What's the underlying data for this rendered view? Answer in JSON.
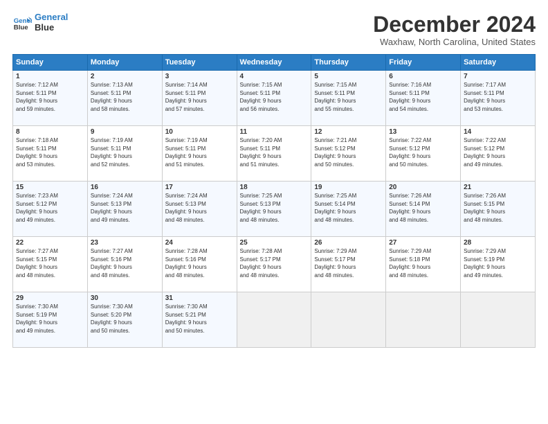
{
  "logo": {
    "line1": "General",
    "line2": "Blue"
  },
  "title": "December 2024",
  "location": "Waxhaw, North Carolina, United States",
  "headers": [
    "Sunday",
    "Monday",
    "Tuesday",
    "Wednesday",
    "Thursday",
    "Friday",
    "Saturday"
  ],
  "weeks": [
    [
      {
        "day": "1",
        "info": "Sunrise: 7:12 AM\nSunset: 5:11 PM\nDaylight: 9 hours\nand 59 minutes."
      },
      {
        "day": "2",
        "info": "Sunrise: 7:13 AM\nSunset: 5:11 PM\nDaylight: 9 hours\nand 58 minutes."
      },
      {
        "day": "3",
        "info": "Sunrise: 7:14 AM\nSunset: 5:11 PM\nDaylight: 9 hours\nand 57 minutes."
      },
      {
        "day": "4",
        "info": "Sunrise: 7:15 AM\nSunset: 5:11 PM\nDaylight: 9 hours\nand 56 minutes."
      },
      {
        "day": "5",
        "info": "Sunrise: 7:15 AM\nSunset: 5:11 PM\nDaylight: 9 hours\nand 55 minutes."
      },
      {
        "day": "6",
        "info": "Sunrise: 7:16 AM\nSunset: 5:11 PM\nDaylight: 9 hours\nand 54 minutes."
      },
      {
        "day": "7",
        "info": "Sunrise: 7:17 AM\nSunset: 5:11 PM\nDaylight: 9 hours\nand 53 minutes."
      }
    ],
    [
      {
        "day": "8",
        "info": "Sunrise: 7:18 AM\nSunset: 5:11 PM\nDaylight: 9 hours\nand 53 minutes."
      },
      {
        "day": "9",
        "info": "Sunrise: 7:19 AM\nSunset: 5:11 PM\nDaylight: 9 hours\nand 52 minutes."
      },
      {
        "day": "10",
        "info": "Sunrise: 7:19 AM\nSunset: 5:11 PM\nDaylight: 9 hours\nand 51 minutes."
      },
      {
        "day": "11",
        "info": "Sunrise: 7:20 AM\nSunset: 5:11 PM\nDaylight: 9 hours\nand 51 minutes."
      },
      {
        "day": "12",
        "info": "Sunrise: 7:21 AM\nSunset: 5:12 PM\nDaylight: 9 hours\nand 50 minutes."
      },
      {
        "day": "13",
        "info": "Sunrise: 7:22 AM\nSunset: 5:12 PM\nDaylight: 9 hours\nand 50 minutes."
      },
      {
        "day": "14",
        "info": "Sunrise: 7:22 AM\nSunset: 5:12 PM\nDaylight: 9 hours\nand 49 minutes."
      }
    ],
    [
      {
        "day": "15",
        "info": "Sunrise: 7:23 AM\nSunset: 5:12 PM\nDaylight: 9 hours\nand 49 minutes."
      },
      {
        "day": "16",
        "info": "Sunrise: 7:24 AM\nSunset: 5:13 PM\nDaylight: 9 hours\nand 49 minutes."
      },
      {
        "day": "17",
        "info": "Sunrise: 7:24 AM\nSunset: 5:13 PM\nDaylight: 9 hours\nand 48 minutes."
      },
      {
        "day": "18",
        "info": "Sunrise: 7:25 AM\nSunset: 5:13 PM\nDaylight: 9 hours\nand 48 minutes."
      },
      {
        "day": "19",
        "info": "Sunrise: 7:25 AM\nSunset: 5:14 PM\nDaylight: 9 hours\nand 48 minutes."
      },
      {
        "day": "20",
        "info": "Sunrise: 7:26 AM\nSunset: 5:14 PM\nDaylight: 9 hours\nand 48 minutes."
      },
      {
        "day": "21",
        "info": "Sunrise: 7:26 AM\nSunset: 5:15 PM\nDaylight: 9 hours\nand 48 minutes."
      }
    ],
    [
      {
        "day": "22",
        "info": "Sunrise: 7:27 AM\nSunset: 5:15 PM\nDaylight: 9 hours\nand 48 minutes."
      },
      {
        "day": "23",
        "info": "Sunrise: 7:27 AM\nSunset: 5:16 PM\nDaylight: 9 hours\nand 48 minutes."
      },
      {
        "day": "24",
        "info": "Sunrise: 7:28 AM\nSunset: 5:16 PM\nDaylight: 9 hours\nand 48 minutes."
      },
      {
        "day": "25",
        "info": "Sunrise: 7:28 AM\nSunset: 5:17 PM\nDaylight: 9 hours\nand 48 minutes."
      },
      {
        "day": "26",
        "info": "Sunrise: 7:29 AM\nSunset: 5:17 PM\nDaylight: 9 hours\nand 48 minutes."
      },
      {
        "day": "27",
        "info": "Sunrise: 7:29 AM\nSunset: 5:18 PM\nDaylight: 9 hours\nand 48 minutes."
      },
      {
        "day": "28",
        "info": "Sunrise: 7:29 AM\nSunset: 5:19 PM\nDaylight: 9 hours\nand 49 minutes."
      }
    ],
    [
      {
        "day": "29",
        "info": "Sunrise: 7:30 AM\nSunset: 5:19 PM\nDaylight: 9 hours\nand 49 minutes."
      },
      {
        "day": "30",
        "info": "Sunrise: 7:30 AM\nSunset: 5:20 PM\nDaylight: 9 hours\nand 50 minutes."
      },
      {
        "day": "31",
        "info": "Sunrise: 7:30 AM\nSunset: 5:21 PM\nDaylight: 9 hours\nand 50 minutes."
      },
      {
        "day": "",
        "info": ""
      },
      {
        "day": "",
        "info": ""
      },
      {
        "day": "",
        "info": ""
      },
      {
        "day": "",
        "info": ""
      }
    ]
  ]
}
